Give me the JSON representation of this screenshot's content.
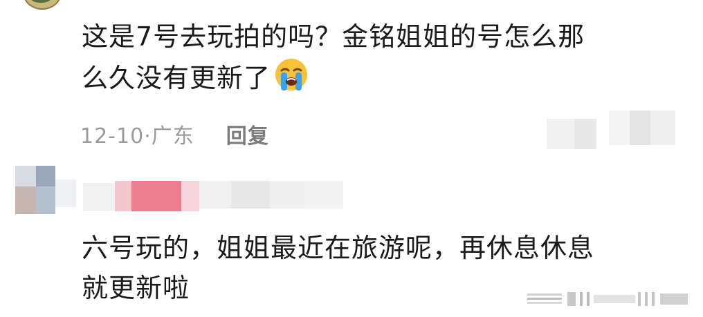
{
  "comment1": {
    "line1": "这是7号去玩拍的吗？金铭姐姐的号怎么那",
    "line2": "么久没有更新了",
    "emoji": "loudly-crying-face-icon",
    "date": "12-10",
    "dot": "·",
    "location": "广东",
    "reply_label": "回复"
  },
  "reply_comment": {
    "line1": "六号玩的，姐姐最近在旅游呢，再休息休息",
    "line2": "就更新啦"
  },
  "colors": {
    "text": "#1a1a1a",
    "meta": "#9a9a9a",
    "emoji_face": "#f7c23a",
    "emoji_tear": "#3aa0f0"
  }
}
